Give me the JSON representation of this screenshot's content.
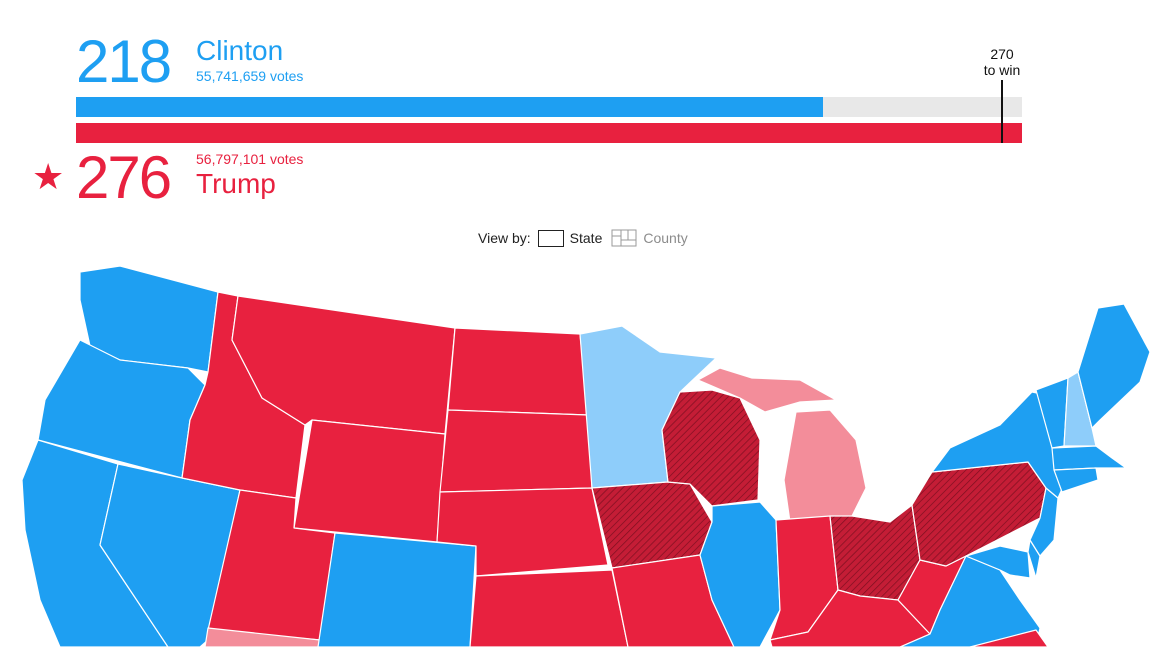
{
  "header": {
    "democrat": {
      "electoral_votes": "218",
      "name": "Clinton",
      "popular_votes": "55,741,659 votes",
      "color": "#1e9ff2",
      "bar_fraction": 0.79
    },
    "republican": {
      "electoral_votes": "276",
      "name": "Trump",
      "popular_votes": "56,797,101 votes",
      "color": "#e8213f",
      "bar_fraction": 1.0,
      "winner_star": "★"
    },
    "threshold": {
      "line1": "270",
      "line2": "to win"
    }
  },
  "view_by": {
    "label": "View by:",
    "options": [
      "State",
      "County"
    ],
    "selected": "State"
  },
  "map_colors": {
    "dem": "#1e9ff2",
    "dem_lean": "#8ecdfa",
    "rep": "#e8213f",
    "rep_lean": "#f38d9a",
    "rep_flip": "#c41d36"
  }
}
